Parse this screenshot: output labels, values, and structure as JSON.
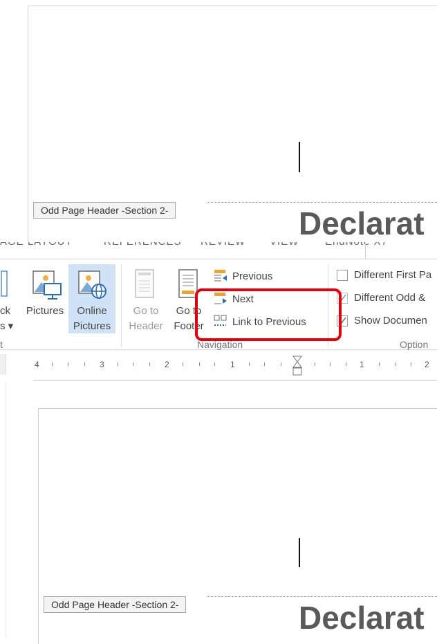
{
  "document": {
    "section_tag": "Odd Page Header -Section 2-",
    "heading_text": "Declarat"
  },
  "ribbon": {
    "tabs": [
      "AGE LAYOUT",
      "REFERENCES",
      "REVIEW",
      "VIEW",
      "EndNote X7"
    ],
    "insert": {
      "partial_label_1": "ck",
      "partial_label_2": "s",
      "partial_label_3": "t",
      "pictures_label": "Pictures",
      "online_pictures_line1": "Online",
      "online_pictures_line2": "Pictures"
    },
    "navigation": {
      "go_to_header_line1": "Go to",
      "go_to_header_line2": "Header",
      "go_to_footer_line1": "Go to",
      "go_to_footer_line2": "Footer",
      "previous_label": "Previous",
      "next_label": "Next",
      "link_to_previous_label": "Link to Previous",
      "group_label": "Navigation"
    },
    "options": {
      "different_first_page": "Different First Pa",
      "different_odd_even": "Different Odd &",
      "show_document_text": "Show Documen",
      "group_label": "Option",
      "different_first_page_checked": false,
      "different_odd_even_checked": true,
      "show_document_text_checked": true
    },
    "highlight_color": "#cfe2f6",
    "annotation_color": "#e0000b"
  },
  "ruler": {
    "labels": [
      "4",
      "3",
      "2",
      "1",
      "1",
      "2"
    ]
  }
}
